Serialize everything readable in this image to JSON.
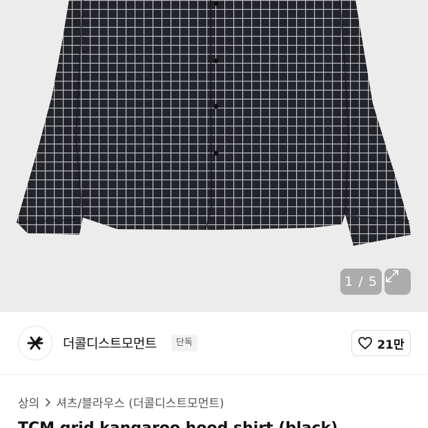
{
  "gallery": {
    "counter": "1 / 5",
    "expand_icon": "expand-icon",
    "background": "#ececec"
  },
  "brand": {
    "name": "더콜디스트모먼트",
    "badge": "단독",
    "logo_icon": "star-logo-icon",
    "like_count": "21만",
    "like_icon": "heart-icon"
  },
  "breadcrumb": {
    "category": "상의",
    "subcategory": "셔츠/블라우스 (더콜디스트모먼트)",
    "separator_icon": "chevron-right-icon"
  },
  "product": {
    "title": "TCM grid kangaroo hood shirt (black)"
  }
}
